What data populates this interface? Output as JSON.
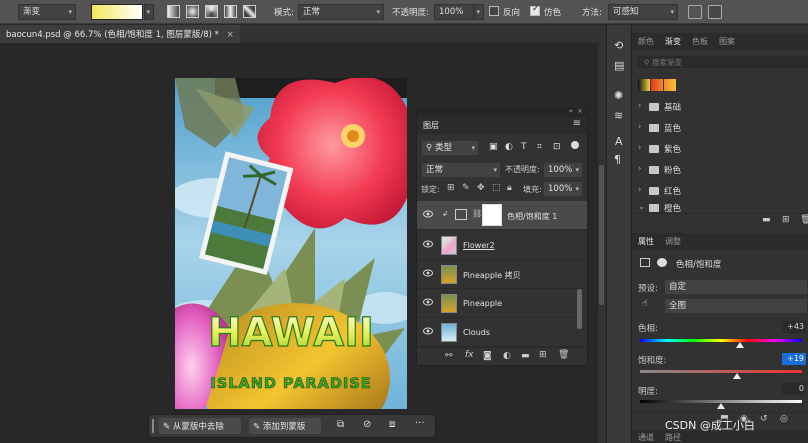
{
  "options_bar": {
    "tool_preset": "渐变",
    "mode_label": "模式:",
    "mode_value": "正常",
    "opacity_label": "不透明度:",
    "opacity_value": "100%",
    "reverse_label": "反向",
    "dither_label": "仿色",
    "method_label": "方法:",
    "method_value": "可感知",
    "gradient_colors": [
      "#f2e85a",
      "#ffffff"
    ]
  },
  "document_tab": {
    "title": "baocun4.psd @ 66.7% (色相/饱和度 1, 图层蒙版/8) *",
    "close": "×"
  },
  "poster": {
    "title": "HAWAII",
    "subtitle": "ISLAND PARADISE"
  },
  "layers_panel": {
    "tab": "图层",
    "filter_kind": "类型",
    "blend_mode": "正常",
    "opacity_label": "不透明度:",
    "opacity_value": "100%",
    "lock_label": "锁定:",
    "fill_label": "填充:",
    "fill_value": "100%",
    "layers": [
      {
        "name": "色相/饱和度 1",
        "type": "adjustment",
        "selected": true
      },
      {
        "name": "Flower2",
        "type": "pixel",
        "selected": false
      },
      {
        "name": "Pineapple 拷贝",
        "type": "pixel",
        "selected": false
      },
      {
        "name": "Pineapple",
        "type": "pixel",
        "selected": false
      },
      {
        "name": "Clouds",
        "type": "pixel",
        "selected": false
      }
    ]
  },
  "context_bar": {
    "remove_from_mask": "从蒙版中去除",
    "add_to_mask": "添加到蒙版",
    "more": "···"
  },
  "swatches_panel": {
    "tabs": [
      "颜色",
      "渐变",
      "色板",
      "图案"
    ],
    "active_tab": "渐变",
    "search_placeholder": "搜索渐变",
    "groups": [
      "基础",
      "蓝色",
      "紫色",
      "粉色",
      "红色",
      "橙色"
    ]
  },
  "properties_panel": {
    "tabs": [
      "属性",
      "调整"
    ],
    "active_tab": "属性",
    "adjustment_title": "色相/饱和度",
    "preset_label": "预设:",
    "preset_value": "自定",
    "channel_value": "全图",
    "hue_label": "色相:",
    "hue_value": "+43",
    "saturation_label": "饱和度:",
    "saturation_value": "+19",
    "lightness_label": "明度:",
    "lightness_value": "0",
    "hue_level": 0.62,
    "saturation_level": 0.6,
    "lightness_level": 0.5
  },
  "bottom_tabs": [
    "通道",
    "路径"
  ],
  "watermark": "CSDN @成工小白"
}
